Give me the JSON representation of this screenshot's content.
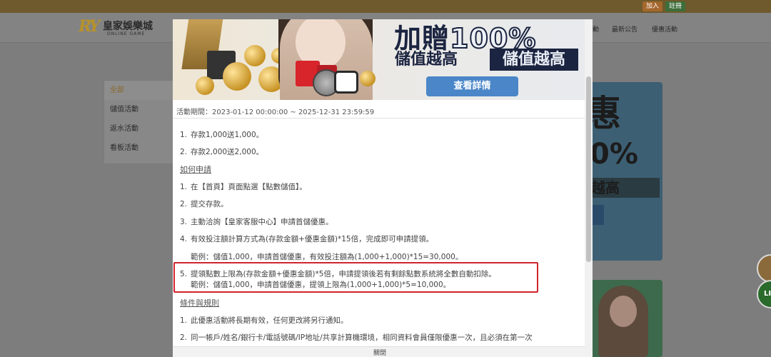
{
  "topbar": {
    "join_label": "加入",
    "register_label": "註冊"
  },
  "brand": {
    "logo_mark": "RY",
    "name": "皇家娛樂城",
    "subtitle": "ONLINE GAME"
  },
  "nav": {
    "fragment": "動",
    "news": "最新公告",
    "promo": "優惠活動"
  },
  "sidebar": {
    "items": [
      {
        "label": "全部",
        "active": true
      },
      {
        "label": "儲值活動"
      },
      {
        "label": "返水活動"
      },
      {
        "label": "看板活動"
      }
    ]
  },
  "bg_banner": {
    "line1": "惠",
    "line2": "0%",
    "line3": "越高"
  },
  "bg_fab_line": "LIN",
  "modal": {
    "banner": {
      "headline": "加贈",
      "headline_pct": "100%",
      "tag1": "儲值越高",
      "tag2": "儲值越高",
      "detail_button": "查看詳情"
    },
    "period": "活動期間：2023-01-12 00:00:00 ~ 2025-12-31 23:59:59",
    "rules": [
      {
        "num": "1.",
        "text": "存款1,000送1,000。"
      },
      {
        "num": "2.",
        "text": "存款2,000送2,000。"
      }
    ],
    "apply_heading": "如何申請",
    "steps": [
      {
        "num": "1.",
        "text": "在【首頁】頁面點選【點數儲值】。"
      },
      {
        "num": "2.",
        "text": "提交存款。"
      },
      {
        "num": "3.",
        "text": "主動洽詢【皇家客服中心】申請首儲優惠。"
      },
      {
        "num": "4.",
        "text": "有效投注額計算方式為(存款金額+優惠金額)*15倍，完成即可申請提領。"
      }
    ],
    "example1": "範例：儲值1,000，申請首儲優惠，有效投注額為(1,000+1,000)*15=30,000。",
    "step5": {
      "num": "5.",
      "text": "提領點數上限為(存款金額+優惠金額)*5倍，申請提領後若有剩餘點數系統將全數自動扣除。"
    },
    "example2": "範例：儲值1,000，申請首儲優惠，提領上限為(1,000+1,000)*5=10,000。",
    "terms_heading": "條件與規則",
    "terms": [
      {
        "num": "1.",
        "text": "此優惠活動將長期有效，任何更改將另行通知。"
      },
      {
        "num": "2.",
        "text": "同一帳戶/姓名/銀行卡/電話號碼/IP地址/共享計算機環境，相同資料會員僅限優惠一次，且必須在第一次"
      }
    ],
    "close_label": "關閉"
  }
}
